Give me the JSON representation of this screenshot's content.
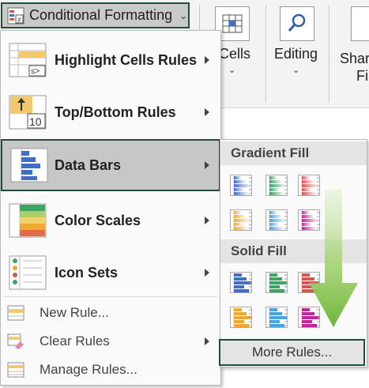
{
  "ribbon": {
    "cf_label": "Conditional Formatting",
    "cells_label": "Cells",
    "editing_label": "Editing",
    "share_label_top": "Shar",
    "share_label_bottom": "Fil",
    "chevron": "⌄"
  },
  "menu": {
    "items": [
      {
        "label": "Highlight Cells Rules",
        "icon": "highlight-cells-icon"
      },
      {
        "label": "Top/Bottom Rules",
        "icon": "top-bottom-icon",
        "icon_text": "10"
      },
      {
        "label": "Data Bars",
        "icon": "data-bars-icon"
      },
      {
        "label": "Color Scales",
        "icon": "color-scales-icon"
      },
      {
        "label": "Icon Sets",
        "icon": "icon-sets-icon"
      }
    ],
    "small_items": [
      {
        "label": "New Rule...",
        "icon": "new-rule-icon"
      },
      {
        "label": "Clear Rules",
        "icon": "clear-rules-icon"
      },
      {
        "label": "Manage Rules...",
        "icon": "manage-rules-icon"
      }
    ]
  },
  "submenu": {
    "gradient_title": "Gradient Fill",
    "solid_title": "Solid Fill",
    "more_rules": "More Rules...",
    "bar_colors": [
      "#3f6fc4",
      "#3aa564",
      "#d9534f",
      "#f0a830",
      "#4aa3df",
      "#c0259a"
    ]
  }
}
